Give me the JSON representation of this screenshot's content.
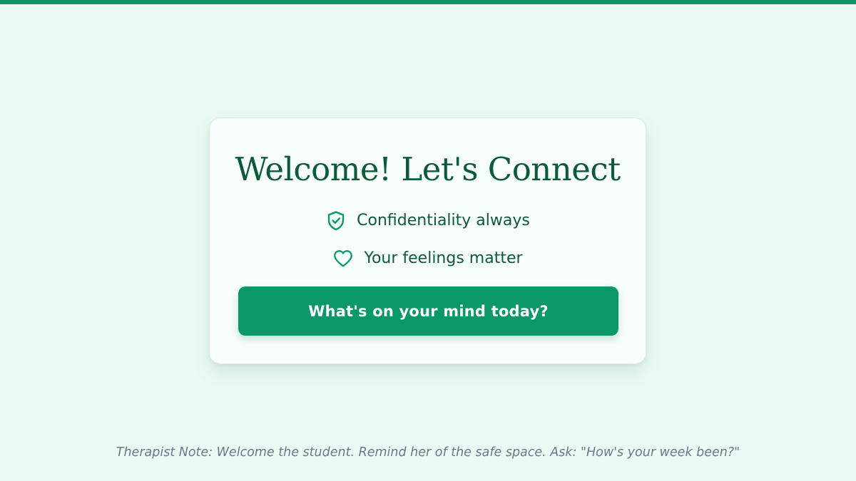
{
  "colors": {
    "accent": "#0a9868",
    "heading": "#0c5a38",
    "background": "#ebfbf3",
    "card": "#f8fefb",
    "note_text": "#6a788c"
  },
  "card": {
    "title": "Welcome! Let's Connect",
    "features": [
      {
        "icon": "shield-check-icon",
        "label": "Confidentiality always"
      },
      {
        "icon": "heart-icon",
        "label": "Your feelings matter"
      }
    ],
    "cta_label": "What's on your mind today?"
  },
  "footer": {
    "note": "Therapist Note: Welcome the student. Remind her of the safe space. Ask: \"How's your week been?\""
  }
}
